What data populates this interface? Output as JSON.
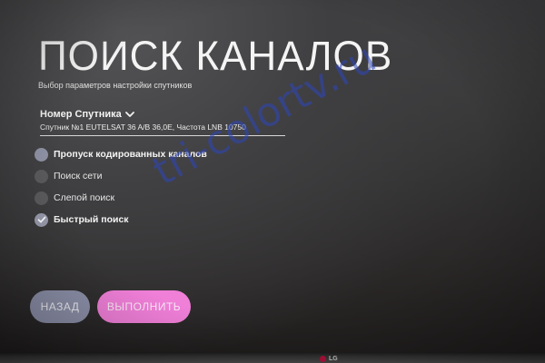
{
  "screen": {
    "title": "ПОИСК КАНАЛОВ",
    "subtitle": "Выбор параметров настройки спутников"
  },
  "satellite": {
    "label": "Номер Спутника",
    "value": "Спутник №1 EUTELSAT 36 A/B 36,0E, Частота LNB 10750"
  },
  "options": [
    {
      "label": "Пропуск кодированных каналов",
      "state": "unchecked-active"
    },
    {
      "label": "Поиск сети",
      "state": "unchecked"
    },
    {
      "label": "Слепой поиск",
      "state": "unchecked"
    },
    {
      "label": "Быстрый поиск",
      "state": "checked"
    }
  ],
  "buttons": {
    "back": "НАЗАД",
    "run": "ВЫПОЛНИТЬ"
  },
  "watermark": "tri-colortv.ru",
  "brand": "LG",
  "colors": {
    "back_button": "#8e92ab",
    "run_button": "#f07fd8",
    "radio_active": "#8f93a6",
    "radio_dim": "#5b5b5e",
    "watermark": "#2d46b9",
    "brand_logo": "#b2113a"
  },
  "icons": {
    "satellite_dropdown": "chevron-down-icon",
    "checked_option": "check-icon"
  }
}
